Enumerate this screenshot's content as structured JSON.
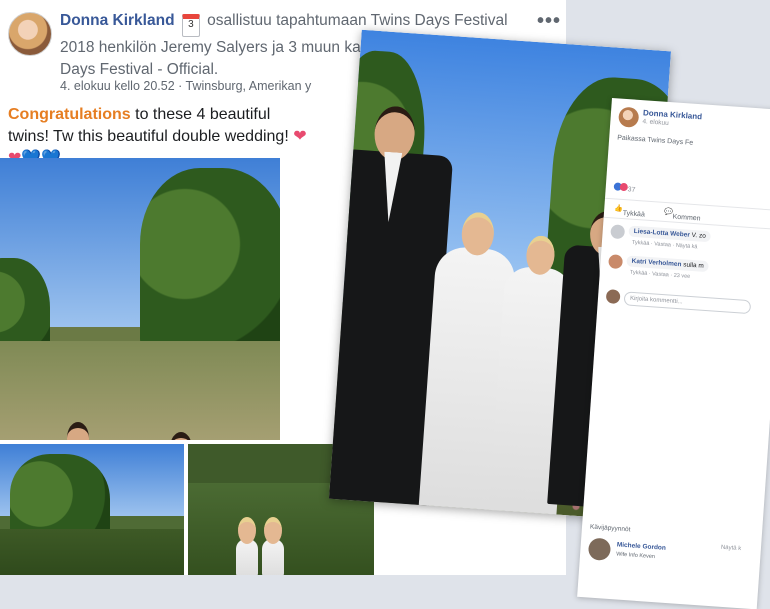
{
  "post": {
    "author": "Donna Kirkland",
    "calendar_day": "3",
    "event_text": " osallistuu tapahtumaan Twins Days Festival 2018 henkilön Jeremy Salyers ja 3 muun kanssa paikassa Twins Days Festival - Official.",
    "meta": "4. elokuu kello 20.52 · Twinsburg, Amerikan y",
    "caption_highlight": "Congratulations",
    "caption_rest": " to these 4 beautiful twins! Tw this beautiful double wedding!",
    "hearts_pink": "❤❤",
    "hearts_blue": "💙💙",
    "more_label": "•••"
  },
  "panel": {
    "author": "Donna Kirkland",
    "date": "4. elokuu",
    "event": "Paikassa Twins Days Fe",
    "reaction_count": "37",
    "like_label": "Tykkää",
    "comment_label": "Kommen",
    "comments": [
      {
        "name": "Liesa-Lotta Weber",
        "text": "V. zo",
        "sub": "Tykkää · Vastaa · Näytä kä"
      },
      {
        "name": "Katri Verholmen",
        "text": "sulla m",
        "sub": "Tykkää · Vastaa · 23 vee"
      }
    ],
    "input_placeholder": "Kirjoita kommentti...",
    "section_label": "Kävijäpyynnöt",
    "guest_name": "Michele Gordon",
    "guest_sub": "Wife Info Keven",
    "see_more": "Näytä k"
  },
  "colors": {
    "link": "#385898",
    "highlight": "#e67e22",
    "heart_pink": "#e84a6f",
    "heart_blue": "#3b73d6"
  }
}
